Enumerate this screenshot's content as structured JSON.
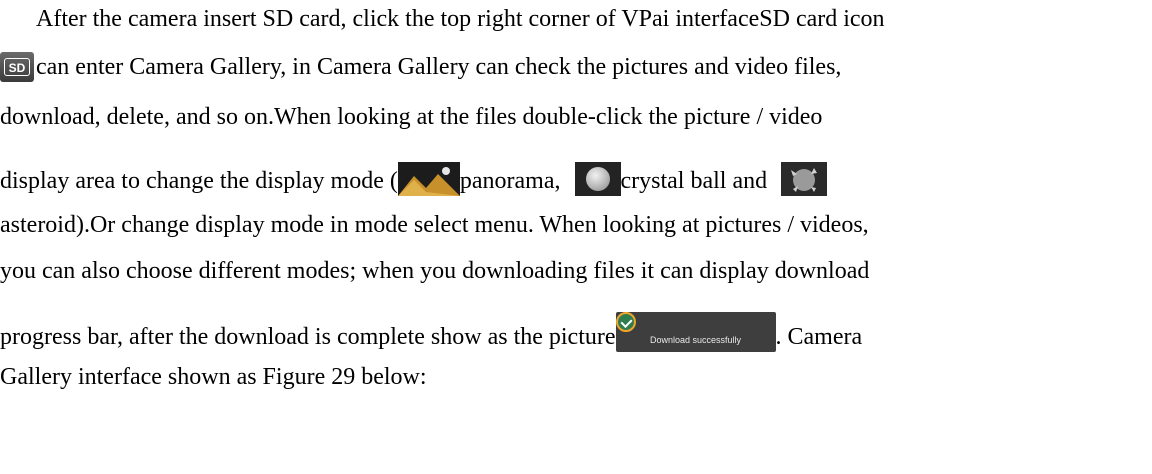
{
  "paragraph": {
    "line1": "After the camera insert SD card, click the top right corner of VPai interfaceSD card icon",
    "sd_icon_text": "SD",
    "line2_text": "can enter Camera Gallery, in Camera Gallery can check the pictures and video files,",
    "line3": "download, delete, and so on.When looking at the files double-click the picture / video",
    "line4_before": "display area to change the display mode (",
    "line4_panorama": "panorama,",
    "line4_crystal": "crystal ball and",
    "line5": "asteroid).Or change display mode in mode select menu. When looking at pictures / videos,",
    "line6": "you can also choose different modes; when you downloading files it can display download",
    "line7_before": "progress bar,   after the download is complete show as the picture",
    "line7_after": ". Camera",
    "line8": "Gallery interface shown as Figure 29 below:"
  },
  "toast": {
    "text": "Download successfully"
  },
  "icons": {
    "sd": "sd-card-icon",
    "panorama": "panorama-mode-icon",
    "crystal_ball": "crystal-ball-mode-icon",
    "asteroid": "asteroid-mode-icon",
    "download_success": "download-success-icon"
  },
  "colors": {
    "text": "#000000",
    "toast_bg": "#3e3e3e",
    "toast_text": "#e8e8e8",
    "sd_icon_bg": "#4a4a4a",
    "panorama_sky": "#1c1c1c",
    "panorama_land": "#c8902a"
  }
}
